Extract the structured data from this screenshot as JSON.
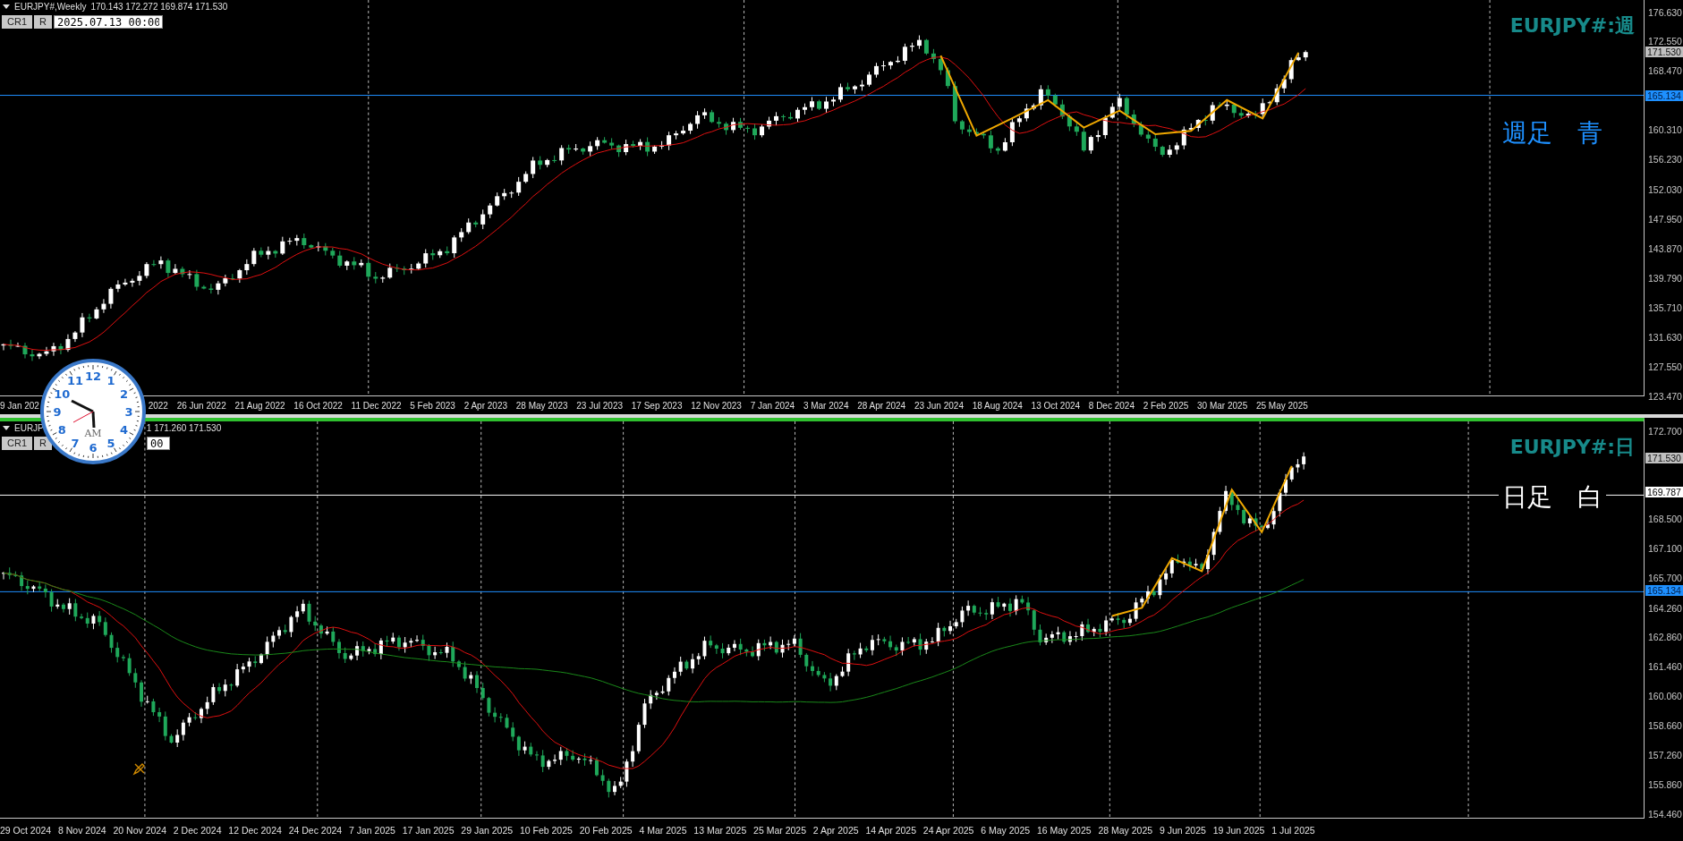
{
  "panes": [
    {
      "symbol_label": "EURJPY#,Weekly",
      "ohlc": "170.143 172.272 169.874 171.530",
      "buttons": [
        "CR1",
        "R"
      ],
      "time_field": {
        "value": "2025.07.13 00:00"
      },
      "title": "EURJPY#:週",
      "note": "週足　青",
      "price_ticks": [
        "176.630",
        "172.550",
        "168.470",
        "160.310",
        "156.230",
        "152.030",
        "147.950",
        "143.870",
        "139.790",
        "135.710",
        "131.630",
        "127.550",
        "123.470"
      ],
      "price_badges": [
        {
          "text": "171.530",
          "kind": "last"
        },
        {
          "text": "165.134",
          "kind": "blue"
        }
      ],
      "dates": [
        "9 Jan 202",
        "2022",
        "26 Jun 2022",
        "21 Aug 2022",
        "16 Oct 2022",
        "11 Dec 2022",
        "5 Feb 2023",
        "2 Apr 2023",
        "28 May 2023",
        "23 Jul 2023",
        "17 Sep 2023",
        "12 Nov 2023",
        "7 Jan 2024",
        "3 Mar 2024",
        "28 Apr 2024",
        "23 Jun 2024",
        "18 Aug 2024",
        "13 Oct 2024",
        "8 Dec 2024",
        "2 Feb 2025",
        "30 Mar 2025",
        "25 May 2025"
      ]
    },
    {
      "symbol_label": "EURJP",
      "ohlc": "1 171.260 171.530",
      "buttons": [
        "CR1",
        "R"
      ],
      "time_field": {
        "value": "00"
      },
      "title": "EURJPY#:日",
      "note": "日足　白",
      "price_ticks": [
        "172.700",
        "168.500",
        "167.100",
        "165.700",
        "164.260",
        "162.860",
        "161.460",
        "160.060",
        "158.660",
        "157.260",
        "155.860",
        "154.460"
      ],
      "price_badges": [
        {
          "text": "171.530",
          "kind": "last"
        },
        {
          "text": "169.787",
          "kind": "white"
        },
        {
          "text": "165.134",
          "kind": "blue"
        }
      ],
      "dates": [
        "29 Oct 2024",
        "8 Nov 2024",
        "20 Nov 2024",
        "2 Dec 2024",
        "12 Dec 2024",
        "24 Dec 2024",
        "7 Jan 2025",
        "17 Jan 2025",
        "29 Jan 2025",
        "10 Feb 2025",
        "20 Feb 2025",
        "4 Mar 2025",
        "13 Mar 2025",
        "25 Mar 2025",
        "2 Apr 2025",
        "14 Apr 2025",
        "24 Apr 2025",
        "6 May 2025",
        "16 May 2025",
        "28 May 2025",
        "9 Jun 2025",
        "19 Jun 2025",
        "1 Jul 2025"
      ]
    }
  ],
  "clock": {
    "numbers": [
      "12",
      "11",
      "1",
      "10",
      "2",
      "9",
      "3",
      "8",
      "4",
      "7",
      "5",
      "6"
    ],
    "period": "AM"
  }
}
